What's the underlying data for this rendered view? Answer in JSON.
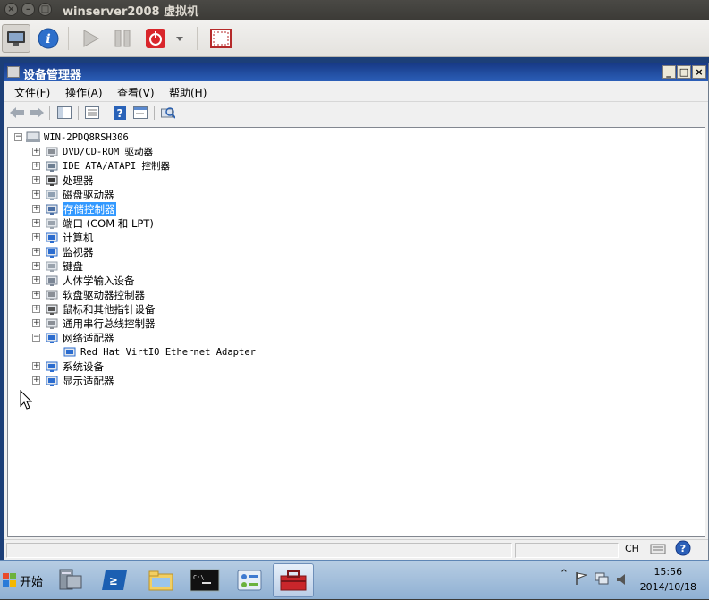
{
  "host": {
    "title": "winserver2008 虚拟机",
    "controls": [
      "close-icon",
      "minimize-icon",
      "maximize-icon"
    ],
    "toolbar": [
      "monitor-icon",
      "info-icon",
      "play-icon",
      "pause-icon",
      "power-icon",
      "dropdown-icon",
      "fullscreen-icon"
    ]
  },
  "device_manager": {
    "title": "设备管理器",
    "window_controls": {
      "minimize": "_",
      "maximize": "□",
      "close": "×"
    },
    "menu": [
      {
        "label": "文件(F)"
      },
      {
        "label": "操作(A)"
      },
      {
        "label": "查看(V)"
      },
      {
        "label": "帮助(H)"
      }
    ],
    "toolbar_icons": [
      "back-icon",
      "forward-icon",
      "show-hide-tree-icon",
      "properties-icon",
      "help-icon",
      "view-icon",
      "scan-hardware-icon"
    ],
    "tree": {
      "root": {
        "label": "WIN-2PDQ8RSH306",
        "expanded": true
      },
      "items": [
        {
          "label": "DVD/CD-ROM 驱动器",
          "icon": "dvd-drive-icon",
          "expanded": false
        },
        {
          "label": "IDE ATA/ATAPI 控制器",
          "icon": "ide-controller-icon",
          "expanded": false
        },
        {
          "label": "处理器",
          "icon": "processor-icon",
          "expanded": false
        },
        {
          "label": "磁盘驱动器",
          "icon": "disk-drive-icon",
          "expanded": false
        },
        {
          "label": "存储控制器",
          "icon": "storage-controller-icon",
          "expanded": false,
          "selected": true
        },
        {
          "label": "端口 (COM 和 LPT)",
          "icon": "port-icon",
          "expanded": false
        },
        {
          "label": "计算机",
          "icon": "computer-icon",
          "expanded": false
        },
        {
          "label": "监视器",
          "icon": "monitor-icon",
          "expanded": false
        },
        {
          "label": "键盘",
          "icon": "keyboard-icon",
          "expanded": false
        },
        {
          "label": "人体学输入设备",
          "icon": "hid-icon",
          "expanded": false
        },
        {
          "label": "软盘驱动器控制器",
          "icon": "floppy-controller-icon",
          "expanded": false
        },
        {
          "label": "鼠标和其他指针设备",
          "icon": "mouse-icon",
          "expanded": false
        },
        {
          "label": "通用串行总线控制器",
          "icon": "usb-icon",
          "expanded": false
        },
        {
          "label": "网络适配器",
          "icon": "network-adapter-icon",
          "expanded": true,
          "children": [
            {
              "label": "Red Hat VirtIO Ethernet Adapter",
              "icon": "network-adapter-icon"
            }
          ]
        },
        {
          "label": "系统设备",
          "icon": "system-device-icon",
          "expanded": false
        },
        {
          "label": "显示适配器",
          "icon": "display-adapter-icon",
          "expanded": false
        }
      ]
    }
  },
  "ime": {
    "label": "CH"
  },
  "taskbar": {
    "start_label": "开始",
    "apps": [
      "server-manager-icon",
      "powershell-icon",
      "explorer-icon",
      "cmd-icon",
      "control-panel-icon",
      "toolbox-icon"
    ],
    "tray": {
      "time": "15:56",
      "date": "2014/10/18"
    }
  },
  "colors": {
    "guest_title": "#1f4a9a",
    "selection": "#3399ff",
    "host_bar": "#3c3b37"
  }
}
